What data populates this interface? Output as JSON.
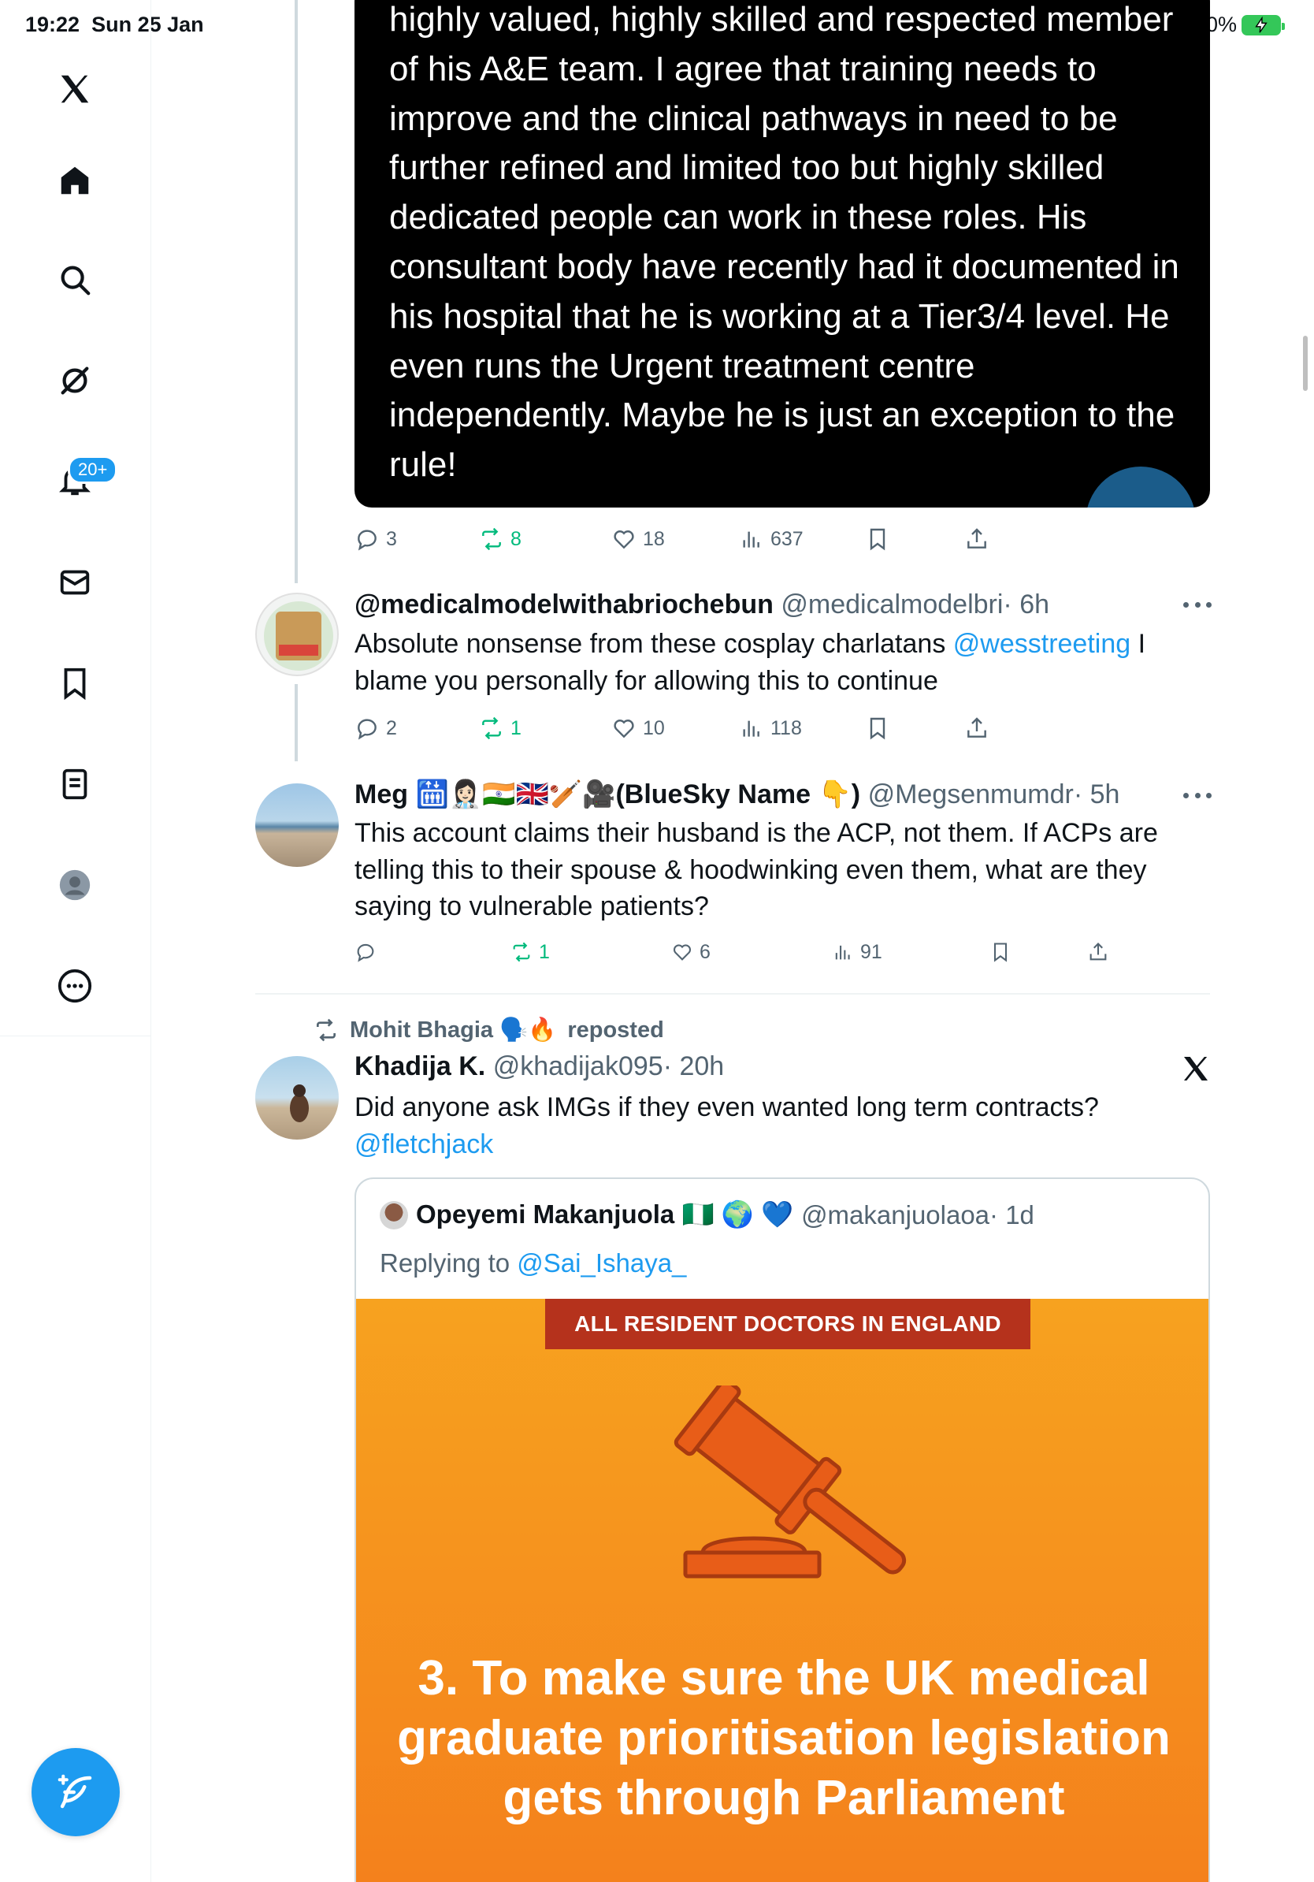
{
  "status": {
    "time": "19:22",
    "date": "Sun 25 Jan",
    "battery": "0%"
  },
  "sidebar": {
    "notifications_badge": "20+"
  },
  "top_card": {
    "text": "highly valued, highly skilled and respected member of his A&E team. I agree that training needs to improve and the clinical pathways in need to be further refined and limited too but highly skilled dedicated people can work in these roles. His consultant body have recently had it documented in his hospital that he is working at a Tier3/4 level. He even runs the Urgent treatment centre independently. Maybe he is just an exception to the rule!"
  },
  "top_actions": {
    "replies": "3",
    "reposts": "8",
    "likes": "18",
    "views": "637"
  },
  "tweet1": {
    "name": "@medicalmodelwithabriochebun",
    "handle": "@medicalmodelbri",
    "time": "· 6h",
    "text_a": "Absolute nonsense from these cosplay charlatans ",
    "mention": "@wesstreeting",
    "text_b": " I blame you personally for allowing this to continue",
    "replies": "2",
    "reposts": "1",
    "likes": "10",
    "views": "118"
  },
  "tweet2": {
    "name": "Meg 🛗👩🏻‍⚕️🇮🇳🇬🇧🏏🎥(BlueSky Name 👇)",
    "handle": "@Megsenmumdr",
    "time": "· 5h",
    "text": "This account claims their husband is the ACP, not them. If ACPs are telling this to their spouse & hoodwinking even them, what are they saying to vulnerable patients?",
    "reposts": "1",
    "likes": "6",
    "views": "91"
  },
  "repost_label": {
    "name": "Mohit Bhagia 🗣️🔥",
    "suffix": "reposted"
  },
  "tweet3": {
    "name": "Khadija K.",
    "handle": "@khadijak095",
    "time": "· 20h",
    "text": "Did anyone ask IMGs if they even wanted long term contracts?",
    "mention": "@fletchjack"
  },
  "quoted": {
    "name": "Opeyemi Makanjuola 🇳🇬 🌍 💙",
    "handle": "@makanjuolaoa",
    "time": "· 1d",
    "replying_prefix": "Replying to ",
    "replying_to": "@Sai_Ishaya_",
    "banner": "ALL RESIDENT DOCTORS IN ENGLAND",
    "headline": "3. To make sure the UK medical graduate prioritisation legislation gets through Parliament"
  },
  "colors": {
    "accent": "#1d9bf0",
    "repost_green": "#00ba7c",
    "promo_orange": "#f58a1e",
    "banner_red": "#b5321c"
  }
}
